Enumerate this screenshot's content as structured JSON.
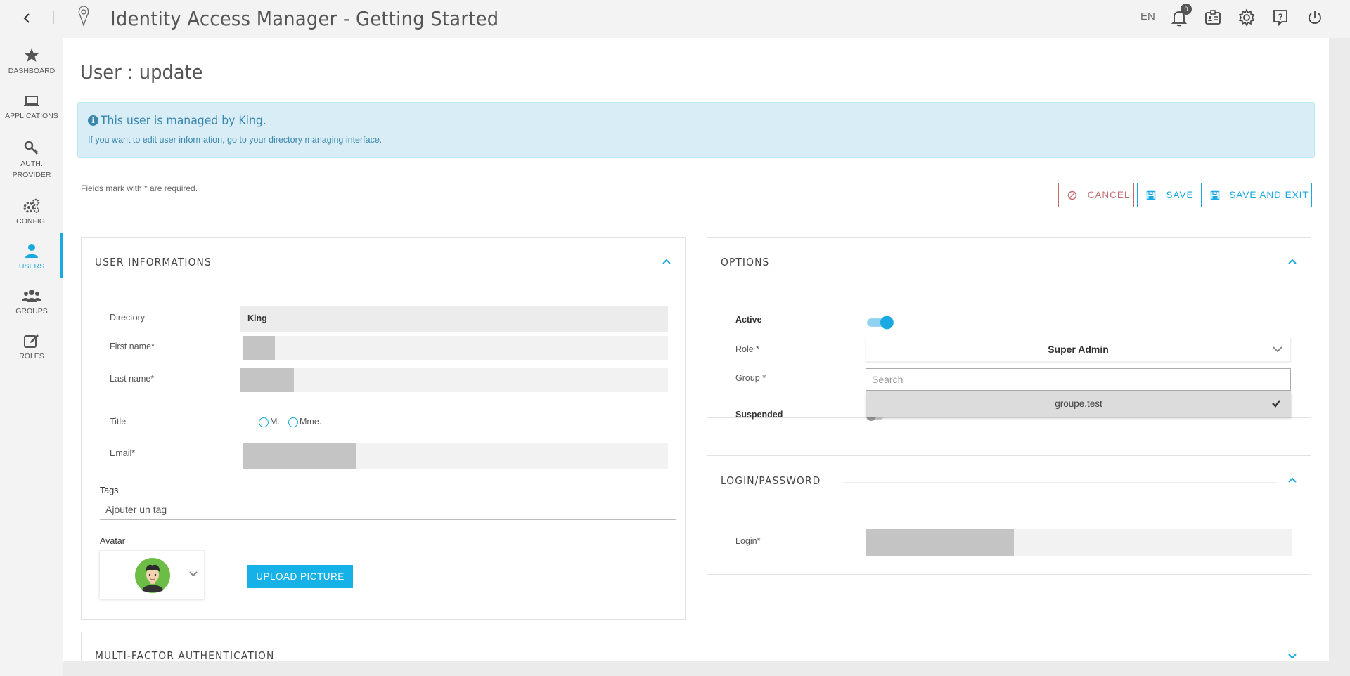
{
  "app": {
    "title": "Identity Access Manager - Getting Started",
    "lang": "EN",
    "notification_count": "0"
  },
  "sidebar": {
    "items": [
      {
        "label": "DASHBOARD",
        "icon": "star-icon"
      },
      {
        "label": "APPLICATIONS",
        "icon": "laptop-icon"
      },
      {
        "label_line1": "AUTH.",
        "label_line2": "PROVIDER",
        "icon": "key-icon"
      },
      {
        "label": "CONFIG.",
        "icon": "gears-icon"
      },
      {
        "label": "USERS",
        "icon": "user-icon",
        "active": true
      },
      {
        "label": "GROUPS",
        "icon": "group-icon"
      },
      {
        "label": "ROLES",
        "icon": "edit-icon"
      }
    ]
  },
  "page": {
    "title": "User : update",
    "alert_title": "This user is managed by King.",
    "alert_text": "If you want to edit user information, go to your directory managing interface.",
    "required_note": "Fields mark with * are required.",
    "cancel_label": "CANCEL",
    "save_label": "SAVE",
    "save_exit_label": "SAVE AND EXIT"
  },
  "user_info": {
    "title": "USER INFORMATIONS",
    "directory_label": "Directory",
    "directory_value": "King",
    "first_name_label": "First name*",
    "last_name_label": "Last name*",
    "title_label": "Title",
    "title_options": [
      "M.",
      "Mme."
    ],
    "email_label": "Email*",
    "tags_label": "Tags",
    "tags_placeholder": "Ajouter un tag",
    "avatar_label": "Avatar",
    "upload_label": "UPLOAD PICTURE"
  },
  "options": {
    "title": "OPTIONS",
    "active_label": "Active",
    "active_value": true,
    "role_label": "Role *",
    "role_value": "Super Admin",
    "group_label": "Group *",
    "group_search_placeholder": "Search",
    "group_option": "groupe.test",
    "suspended_label": "Suspended"
  },
  "login": {
    "title": "LOGIN/PASSWORD",
    "login_label": "Login*"
  },
  "mfa": {
    "title": "MULTI-FACTOR AUTHENTICATION"
  },
  "colors": {
    "accent": "#1aa9e0",
    "cancel": "#c9696a",
    "alert_bg": "#d9edf7"
  }
}
